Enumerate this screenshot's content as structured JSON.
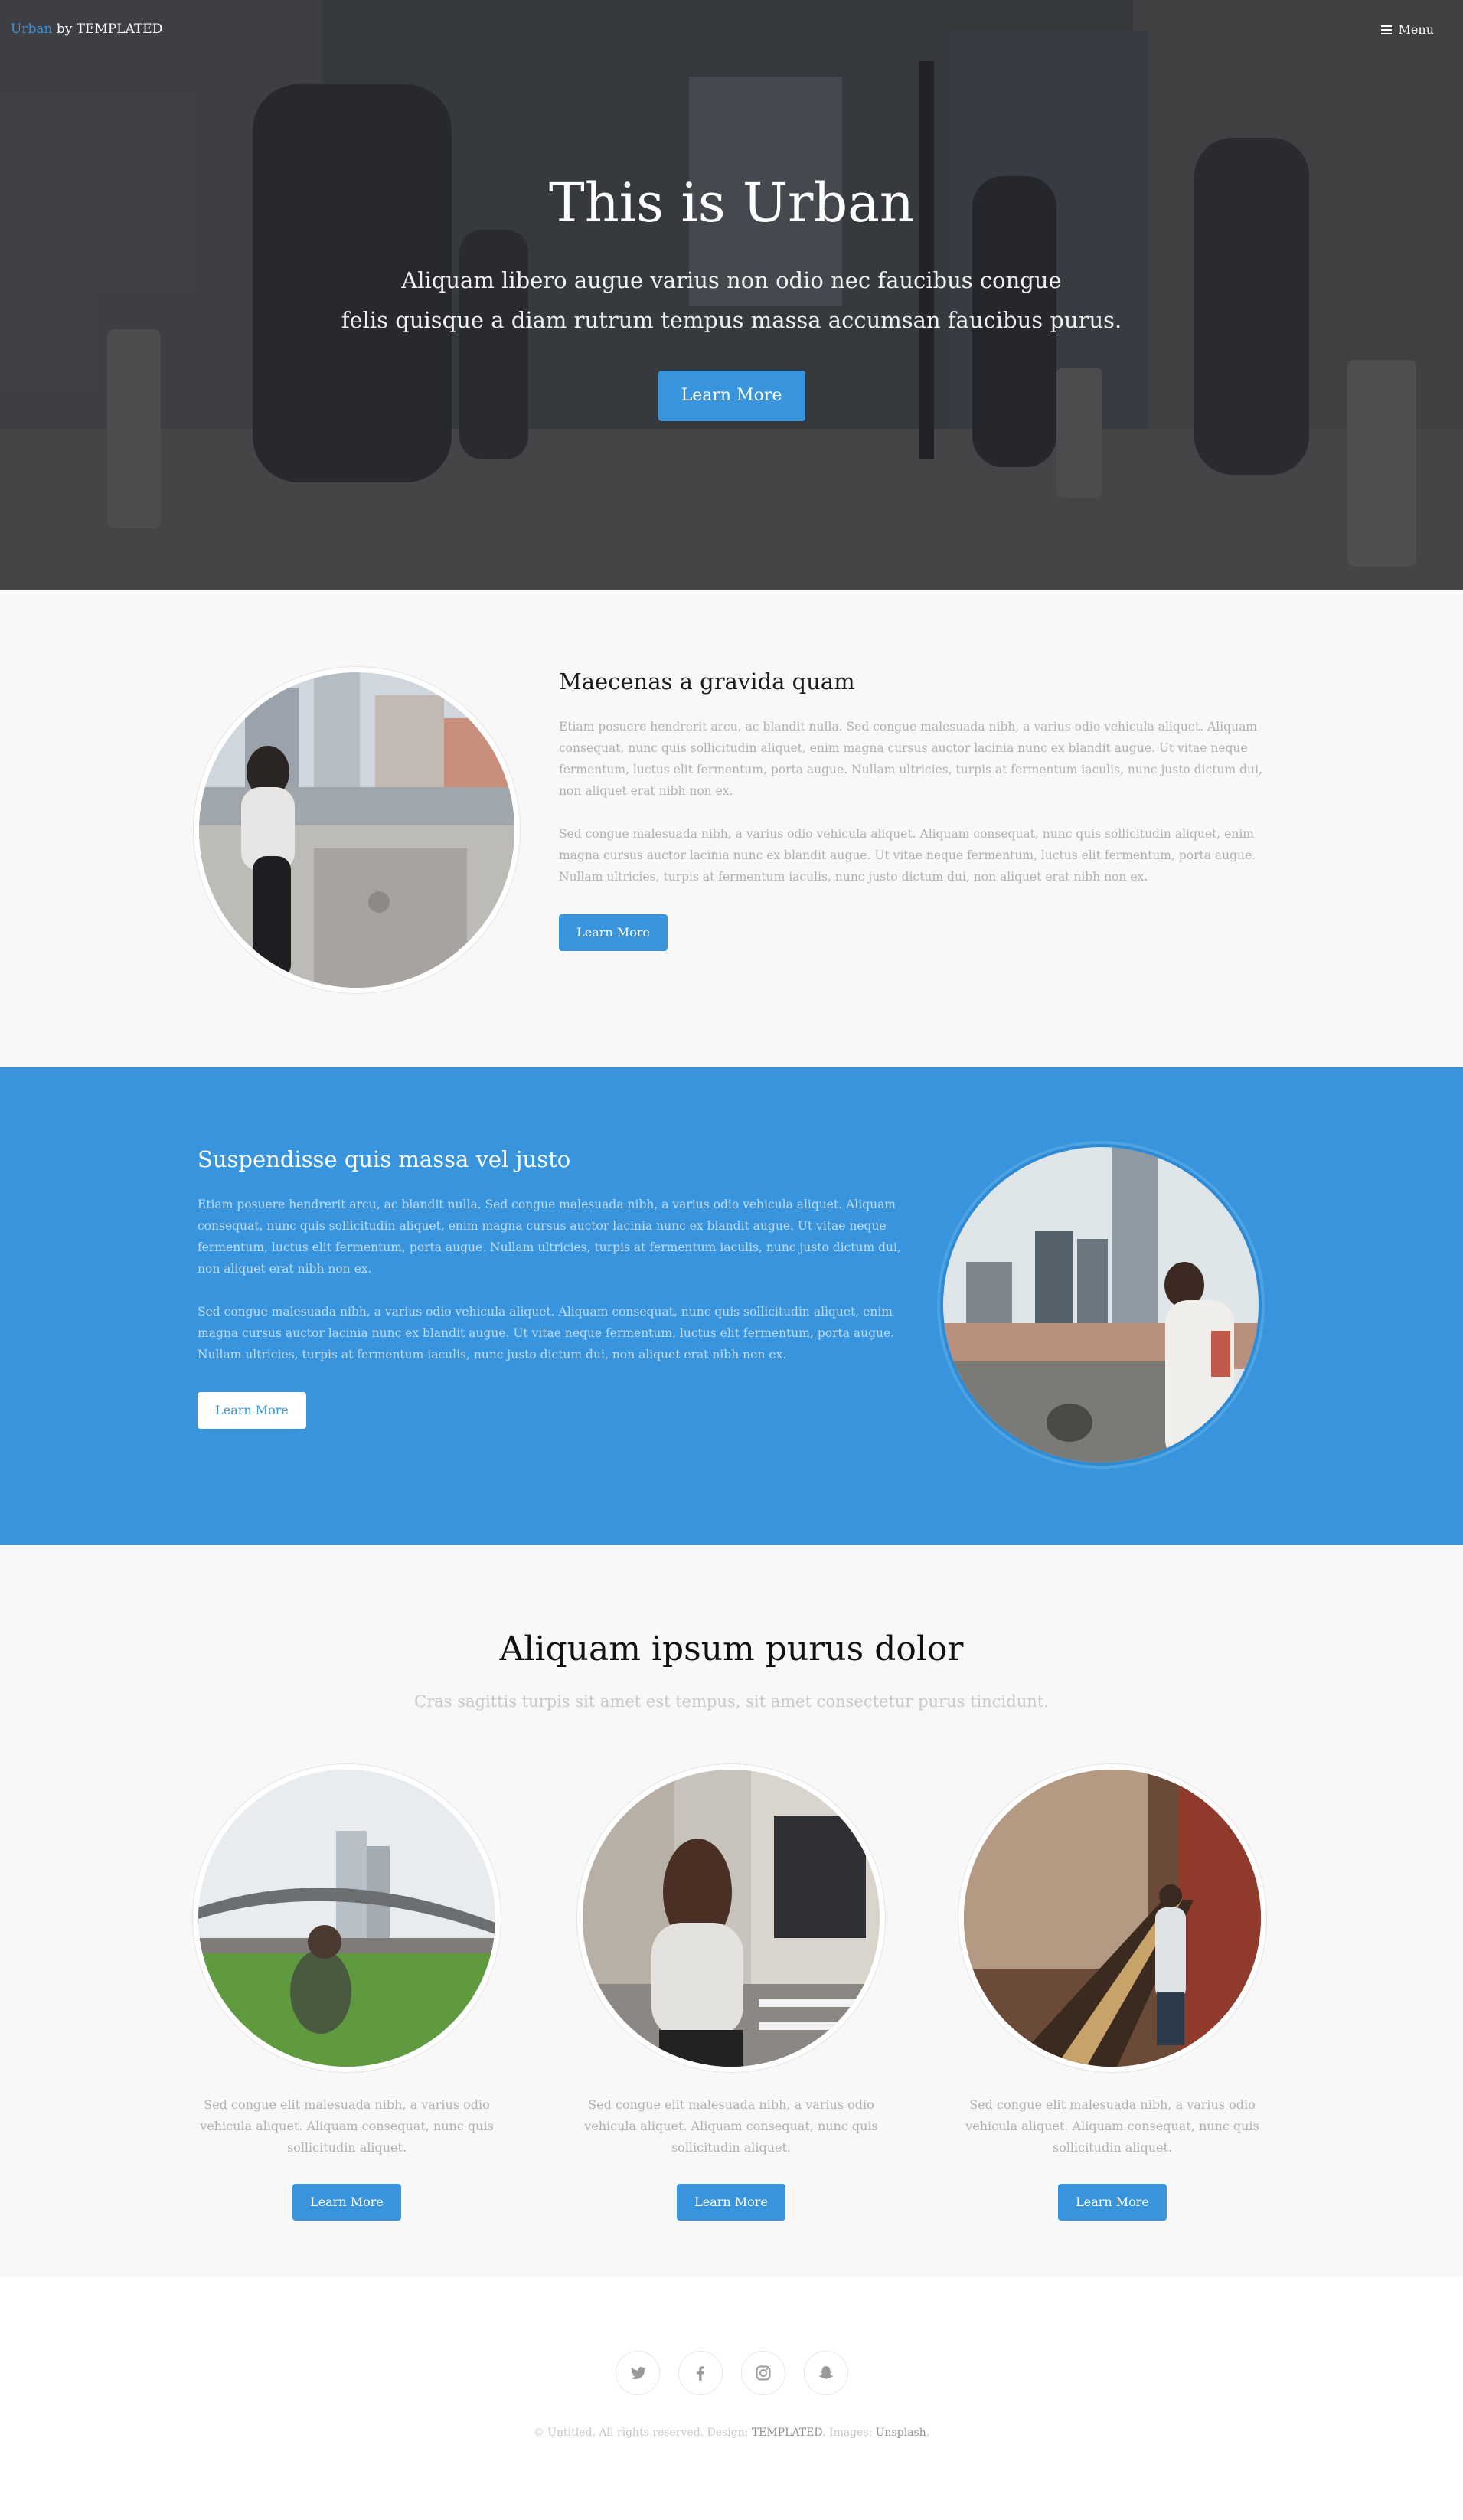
{
  "header": {
    "brand": "Urban",
    "brand_suffix": " by TEMPLATED",
    "menu_label": "Menu"
  },
  "banner": {
    "title": "This is Urban",
    "text_line1": "Aliquam libero augue varius non odio nec faucibus congue",
    "text_line2": "felis quisque a diam rutrum tempus massa accumsan faucibus purus.",
    "button": "Learn More"
  },
  "section_one": {
    "heading": "Maecenas a gravida quam",
    "para1": "Etiam posuere hendrerit arcu, ac blandit nulla. Sed congue malesuada nibh, a varius odio vehicula aliquet. Aliquam consequat, nunc quis sollicitudin aliquet, enim magna cursus auctor lacinia nunc ex blandit augue. Ut vitae neque fermentum, luctus elit fermentum, porta augue. Nullam ultricies, turpis at fermentum iaculis, nunc justo dictum dui, non aliquet erat nibh non ex.",
    "para2": "Sed congue malesuada nibh, a varius odio vehicula aliquet. Aliquam consequat, nunc quis sollicitudin aliquet, enim magna cursus auctor lacinia nunc ex blandit augue. Ut vitae neque fermentum, luctus elit fermentum, porta augue. Nullam ultricies, turpis at fermentum iaculis, nunc justo dictum dui, non aliquet erat nibh non ex.",
    "button": "Learn More"
  },
  "section_two": {
    "heading": "Suspendisse quis massa vel justo",
    "para1": "Etiam posuere hendrerit arcu, ac blandit nulla. Sed congue malesuada nibh, a varius odio vehicula aliquet. Aliquam consequat, nunc quis sollicitudin aliquet, enim magna cursus auctor lacinia nunc ex blandit augue. Ut vitae neque fermentum, luctus elit fermentum, porta augue. Nullam ultricies, turpis at fermentum iaculis, nunc justo dictum dui, non aliquet erat nibh non ex.",
    "para2": "Sed congue malesuada nibh, a varius odio vehicula aliquet. Aliquam consequat, nunc quis sollicitudin aliquet, enim magna cursus auctor lacinia nunc ex blandit augue. Ut vitae neque fermentum, luctus elit fermentum, porta augue. Nullam ultricies, turpis at fermentum iaculis, nunc justo dictum dui, non aliquet erat nibh non ex.",
    "button": "Learn More"
  },
  "section_three": {
    "heading": "Aliquam ipsum purus dolor",
    "subheading": "Cras sagittis turpis sit amet est tempus, sit amet consectetur purus tincidunt.",
    "cards": [
      {
        "text": "Sed congue elit malesuada nibh, a varius odio vehicula aliquet. Aliquam consequat, nunc quis sollicitudin aliquet.",
        "button": "Learn More"
      },
      {
        "text": "Sed congue elit malesuada nibh, a varius odio vehicula aliquet. Aliquam consequat, nunc quis sollicitudin aliquet.",
        "button": "Learn More"
      },
      {
        "text": "Sed congue elit malesuada nibh, a varius odio vehicula aliquet. Aliquam consequat, nunc quis sollicitudin aliquet.",
        "button": "Learn More"
      }
    ]
  },
  "footer": {
    "social_icons": [
      "twitter-icon",
      "facebook-icon",
      "instagram-icon",
      "snapchat-icon"
    ],
    "copyright_prefix": "© Untitled. All rights reserved. Design: ",
    "design_link": "TEMPLATED",
    "images_prefix": ". Images: ",
    "images_link": "Unsplash",
    "suffix": "."
  },
  "colors": {
    "accent": "#3894dc",
    "accent_light_text": "#bfdcf3",
    "heading": "#1c1c1c",
    "body_text": "#b0b0b0",
    "background": "#f8f8f8"
  }
}
